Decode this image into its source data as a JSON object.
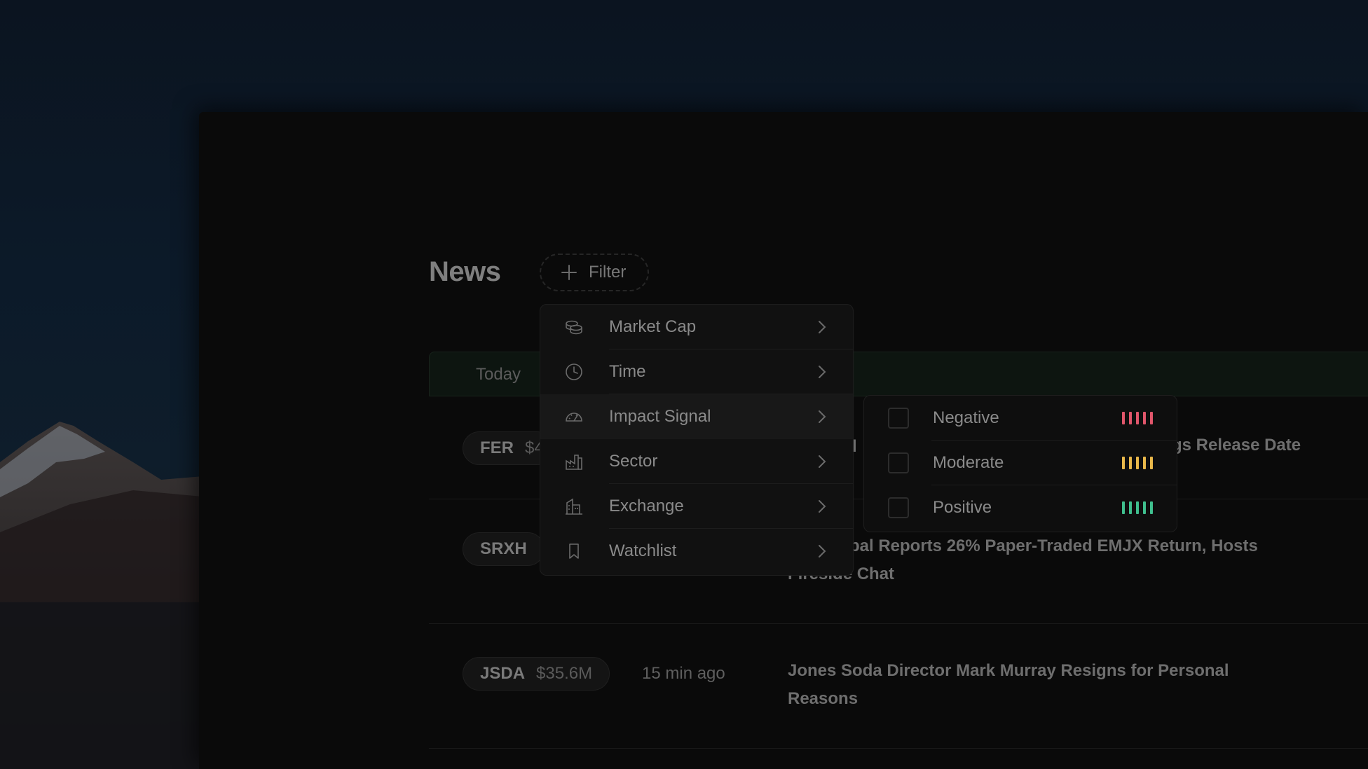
{
  "page": {
    "title": "News",
    "filter_label": "Filter",
    "tab_today": "Today"
  },
  "menu": {
    "items": [
      {
        "label": "Market Cap",
        "icon": "coins-icon"
      },
      {
        "label": "Time",
        "icon": "clock-icon"
      },
      {
        "label": "Impact Signal",
        "icon": "gauge-icon"
      },
      {
        "label": "Sector",
        "icon": "factory-icon"
      },
      {
        "label": "Exchange",
        "icon": "building-icon"
      },
      {
        "label": "Watchlist",
        "icon": "bookmark-icon"
      }
    ],
    "active": "Impact Signal"
  },
  "impact_signal": {
    "options": [
      {
        "label": "Negative",
        "color": "#e0566b",
        "checked": false
      },
      {
        "label": "Moderate",
        "color": "#e9b84a",
        "checked": false
      },
      {
        "label": "Positive",
        "color": "#3fbf8e",
        "checked": false
      }
    ]
  },
  "news": {
    "rows": [
      {
        "ticker": "FER",
        "mcap": "$4",
        "time": "",
        "headline_left": "l",
        "headline_right": "gs Release Date"
      },
      {
        "ticker": "SRXH",
        "mcap": "",
        "time": "",
        "headline": "bal Reports 26% Paper-Traded EMJX Return, Hosts Fireside Chat"
      },
      {
        "ticker": "JSDA",
        "mcap": "$35.6M",
        "time": "15 min ago",
        "headline": "Jones Soda Director Mark Murray Resigns for Personal Reasons"
      }
    ]
  }
}
